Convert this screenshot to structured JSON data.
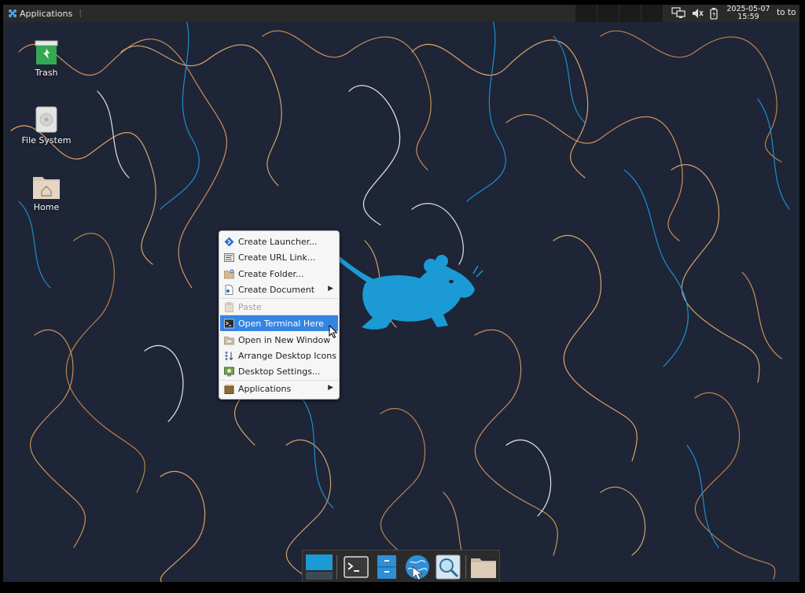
{
  "panel": {
    "applications_label": "Applications",
    "grip": "⋮",
    "clock_date": "2025-05-07",
    "clock_time": "15:59",
    "user_label": "to to"
  },
  "desktop": {
    "icons": [
      {
        "label": "Trash",
        "icon": "trash-icon"
      },
      {
        "label": "File System",
        "icon": "drive-icon"
      },
      {
        "label": "Home",
        "icon": "home-folder-icon"
      }
    ]
  },
  "context_menu": {
    "items": [
      {
        "label": "Create Launcher...",
        "icon": "launcher-icon"
      },
      {
        "label": "Create URL Link...",
        "icon": "url-link-icon"
      },
      {
        "label": "Create Folder...",
        "icon": "new-folder-icon"
      },
      {
        "label": "Create Document",
        "icon": "document-icon",
        "submenu": true
      },
      {
        "label": "Paste",
        "icon": "paste-icon",
        "disabled": true
      },
      {
        "label": "Open Terminal Here",
        "icon": "terminal-icon",
        "highlighted": true
      },
      {
        "label": "Open in New Window",
        "icon": "folder-window-icon"
      },
      {
        "label": "Arrange Desktop Icons",
        "icon": "arrange-icon"
      },
      {
        "label": "Desktop Settings...",
        "icon": "desktop-settings-icon"
      },
      {
        "label": "Applications",
        "icon": "applications-icon",
        "submenu": true
      }
    ],
    "submenu_arrow": "▶"
  },
  "dock": {
    "items": [
      "show-desktop-icon",
      "terminal-icon",
      "file-manager-icon",
      "web-browser-icon",
      "app-finder-icon",
      "folder-icon"
    ]
  },
  "colors": {
    "wallpaper_bg": "#1e2536",
    "mouse_logo": "#1b9ad6",
    "menu_highlight": "#3584e4",
    "panel_bg": "#2a2a2a"
  }
}
